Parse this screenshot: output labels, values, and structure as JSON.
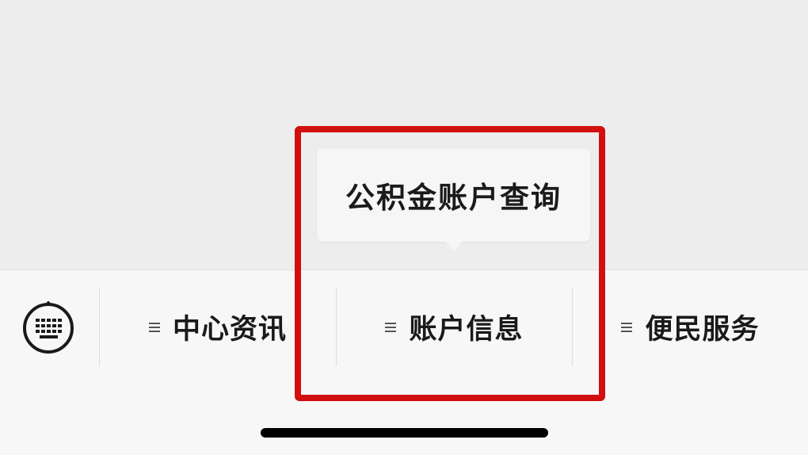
{
  "menu": {
    "items": [
      {
        "label": "中心资讯",
        "icon": "hamburger-icon"
      },
      {
        "label": "账户信息",
        "icon": "hamburger-icon"
      },
      {
        "label": "便民服务",
        "icon": "hamburger-icon"
      }
    ],
    "keyboard_icon": "keyboard-icon"
  },
  "popup": {
    "items": [
      {
        "label": "公积金账户查询"
      }
    ]
  },
  "colors": {
    "highlight": "#d20f0f",
    "menu_background": "#f7f7f7",
    "chat_background": "#ededed",
    "text": "#1a1a1a"
  }
}
